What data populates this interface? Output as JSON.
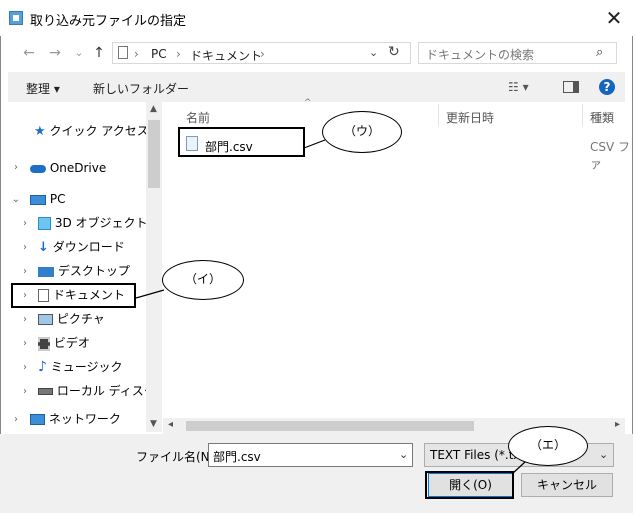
{
  "window": {
    "title": "取り込み元ファイルの指定",
    "close_icon": "close-icon"
  },
  "address": {
    "back_icon": "←",
    "forward_icon": "→",
    "recent_icon": "⌄",
    "up_icon": "↑",
    "crumbs": [
      "PC",
      "ドキュメント"
    ],
    "crumb_sep": "›",
    "search_placeholder": "ドキュメントの検索"
  },
  "toolbar": {
    "organize_label": "整理 ▾",
    "new_folder_label": "新しいフォルダー"
  },
  "sidebar": {
    "items": [
      {
        "label": "クイック アクセス",
        "icon": "star-icon"
      },
      {
        "label": "OneDrive",
        "icon": "cloud-icon"
      },
      {
        "label": "PC",
        "icon": "computer-icon"
      },
      {
        "label": "3D オブジェクト",
        "icon": "cube-icon"
      },
      {
        "label": "ダウンロード",
        "icon": "download-arrow-icon"
      },
      {
        "label": "デスクトップ",
        "icon": "desktop-icon"
      },
      {
        "label": "ドキュメント",
        "icon": "document-icon"
      },
      {
        "label": "ピクチャ",
        "icon": "picture-icon"
      },
      {
        "label": "ビデオ",
        "icon": "film-icon"
      },
      {
        "label": "ミュージック",
        "icon": "music-note-icon"
      },
      {
        "label": "ローカル ディスク (C",
        "icon": "disk-icon"
      },
      {
        "label": "ネットワーク",
        "icon": "network-icon"
      }
    ]
  },
  "columns": {
    "name": "名前",
    "modified": "更新日時",
    "type": "種類"
  },
  "files": [
    {
      "name": "部門.csv",
      "type": "CSV ファ"
    }
  ],
  "bottom": {
    "filename_label": "ファイル名(N):",
    "filename_value": "部門.csv",
    "filter_value": "TEXT Files (*.txt",
    "open_label": "開く(O)",
    "cancel_label": "キャンセル"
  },
  "annotations": {
    "u": "（ウ）",
    "i": "（イ）",
    "e": "（エ）"
  },
  "colors": {
    "help_blue": "#1565c0",
    "accent": "#0078d7"
  }
}
